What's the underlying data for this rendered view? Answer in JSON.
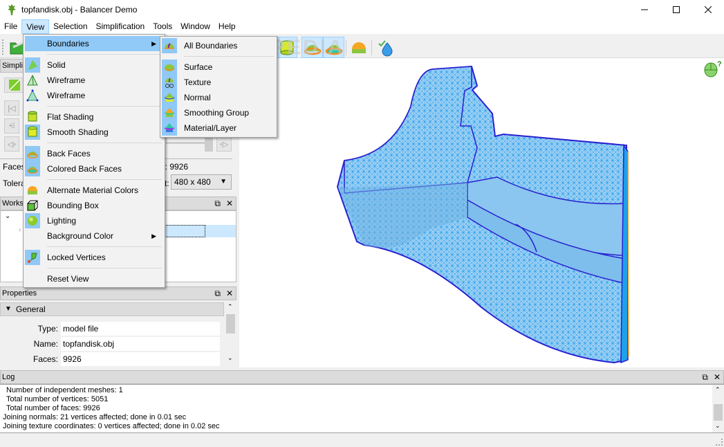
{
  "window": {
    "title": "topfandisk.obj - Balancer Demo",
    "controls": {
      "minimize": "—",
      "maximize": "☐",
      "close": "✕"
    }
  },
  "menubar": {
    "items": [
      {
        "label": "File"
      },
      {
        "label": "View",
        "active": true
      },
      {
        "label": "Selection"
      },
      {
        "label": "Simplification"
      },
      {
        "label": "Tools"
      },
      {
        "label": "Window"
      },
      {
        "label": "Help"
      }
    ]
  },
  "view_menu": {
    "items": [
      {
        "label": "Boundaries",
        "icon": "none",
        "submenu": true,
        "highlighted": true
      },
      {
        "label": "Solid",
        "icon": "solid-pyramid-icon",
        "checked": true
      },
      {
        "label": "Wireframe",
        "icon": "wireframe-pyramid-icon",
        "checked": false
      },
      {
        "label": "Wireframe",
        "icon": "wireframe-vertices-icon",
        "checked": false
      },
      {
        "label": "Flat Shading",
        "icon": "flat-cylinder-icon",
        "checked": false
      },
      {
        "label": "Smooth Shading",
        "icon": "smooth-cylinder-icon",
        "checked": true
      },
      {
        "label": "Back Faces",
        "icon": "back-faces-icon",
        "checked": true
      },
      {
        "label": "Colored Back Faces",
        "icon": "colored-back-faces-icon",
        "checked": true
      },
      {
        "label": "Alternate Material Colors",
        "icon": "material-dome-icon",
        "checked": false
      },
      {
        "label": "Bounding Box",
        "icon": "bounding-box-icon",
        "checked": false
      },
      {
        "label": "Lighting",
        "icon": "lighting-sphere-icon",
        "checked": true
      },
      {
        "label": "Background Color",
        "icon": "none",
        "submenu": true
      },
      {
        "label": "Locked Vertices",
        "icon": "pin-icon",
        "checked": true
      },
      {
        "label": "Reset View",
        "icon": "none"
      }
    ]
  },
  "boundaries_submenu": {
    "items": [
      {
        "label": "All Boundaries",
        "checked": true
      },
      {
        "label": "Surface",
        "checked": true
      },
      {
        "label": "Texture",
        "checked": true
      },
      {
        "label": "Normal",
        "checked": true
      },
      {
        "label": "Smoothing Group",
        "checked": true
      },
      {
        "label": "Material/Layer",
        "checked": true
      }
    ]
  },
  "simplification_panel": {
    "title": "Simplifi",
    "faces_label": "Faces",
    "tolerance_label": "Tolera",
    "total_suffix": "l: 9926",
    "output_suffix": "t:",
    "resolution": "480 x 480"
  },
  "workspace_panel": {
    "title": "Worksp"
  },
  "properties_panel": {
    "title": "Properties",
    "group": "General",
    "rows": [
      {
        "key": "Type:",
        "value": "model file"
      },
      {
        "key": "Name:",
        "value": "topfandisk.obj"
      },
      {
        "key": "Faces:",
        "value": "9926"
      }
    ]
  },
  "log_panel": {
    "title": "Log",
    "lines": [
      "Number of independent meshes: 1",
      "Total number of vertices: 5051",
      "Total number of faces: 9926",
      "Joining normals: 21 vertices affected; done in 0.01 sec",
      "Joining texture coordinates: 0 vertices affected; done in 0.02 sec"
    ]
  },
  "viewport": {
    "model": "topfandisk mesh",
    "mesh_color": "#3aa5f0",
    "boundary_color": "#2a1fd0"
  },
  "dock_controls": {
    "float": "⧉",
    "close": "✕"
  },
  "watermark": "SOFTPEDIA"
}
